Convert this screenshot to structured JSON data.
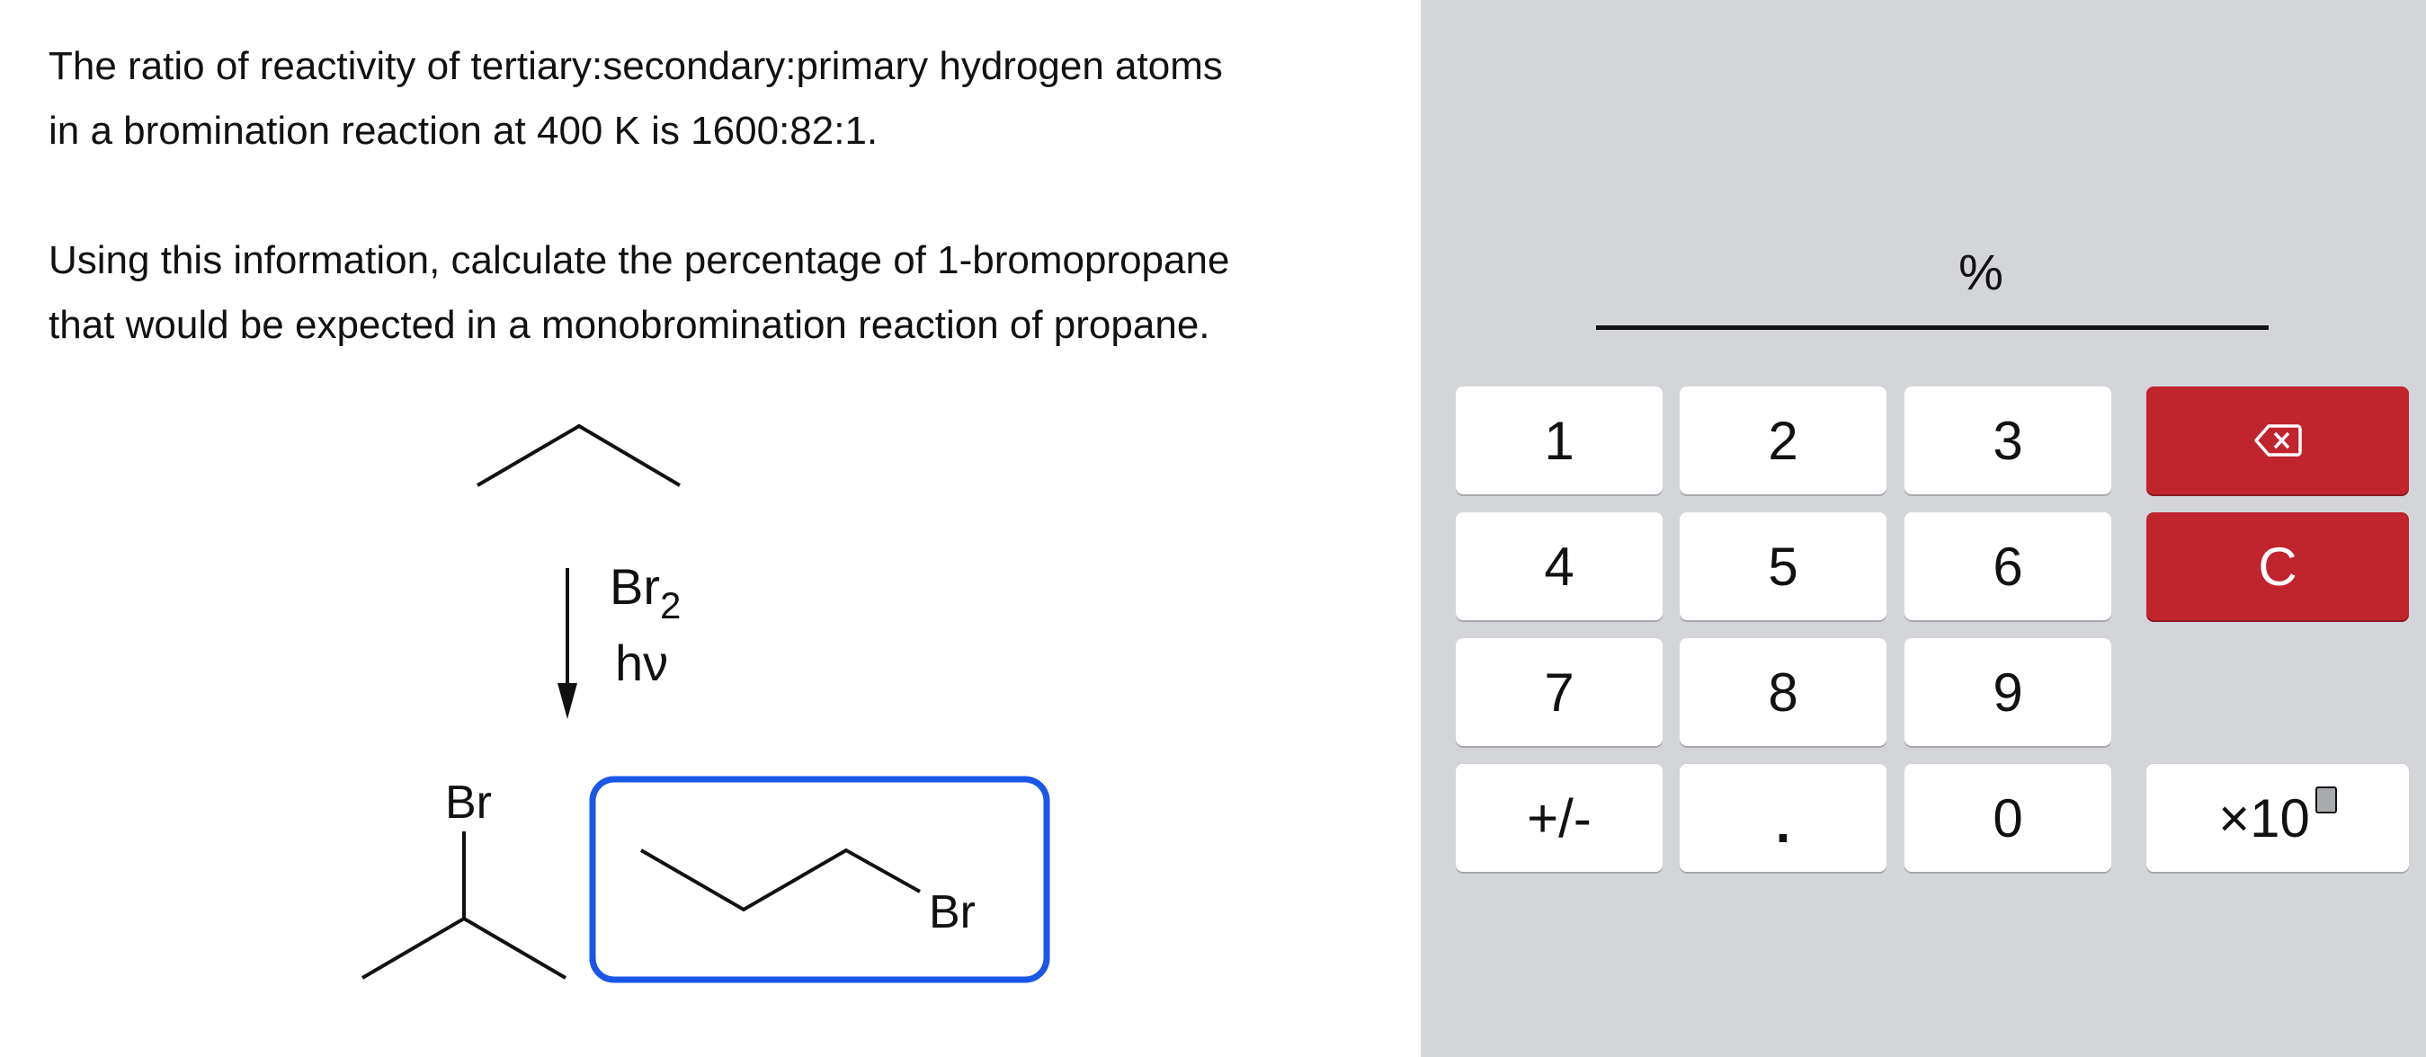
{
  "question": {
    "line1": "The ratio of reactivity of tertiary:secondary:primary hydrogen atoms",
    "line2": "in a bromination reaction at 400 K is 1600:82:1.",
    "line3": "Using this information, calculate the percentage of 1-bromopropane",
    "line4": "that would be expected in a monobromination reaction of propane."
  },
  "scheme": {
    "reagent_main": "Br",
    "reagent_sub": "2",
    "condition": "hν",
    "product_left_label": "Br",
    "product_right_label": "Br"
  },
  "answer": {
    "unit": "%",
    "value": ""
  },
  "keypad": {
    "k1": "1",
    "k2": "2",
    "k3": "3",
    "k4": "4",
    "k5": "5",
    "k6": "6",
    "k7": "7",
    "k8": "8",
    "k9": "9",
    "k0": "0",
    "sign": "+/-",
    "dot": ".",
    "clear": "C",
    "times_ten": "×10",
    "backspace_icon": "backspace-icon"
  },
  "colors": {
    "keypad_bg": "#d4d5d9",
    "danger_red": "#c0242d",
    "selection_blue": "#1a56e8"
  }
}
